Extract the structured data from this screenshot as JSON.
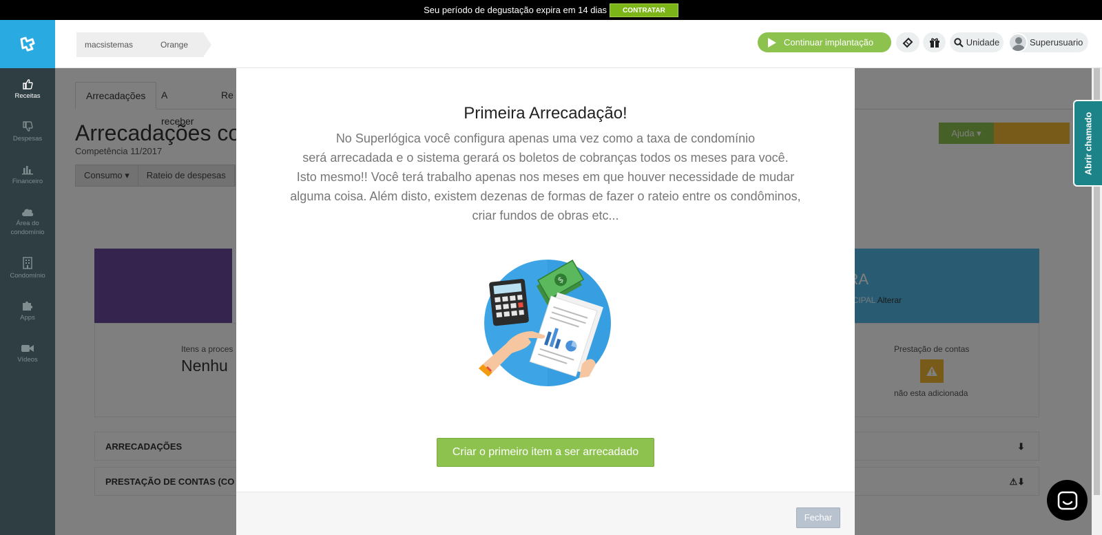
{
  "trial": {
    "text": "Seu período de degustação expira em 14 dias",
    "button": "CONTRATAR"
  },
  "sidebar": {
    "items": [
      {
        "label": "Receitas",
        "icon": "thumbs-up-icon"
      },
      {
        "label": "Despesas",
        "icon": "thumbs-down-icon"
      },
      {
        "label": "Financeiro",
        "icon": "bar-chart-icon"
      },
      {
        "label": "Área do condomínio",
        "icon": "cloud-icon"
      },
      {
        "label": "Condomínio",
        "icon": "building-icon"
      },
      {
        "label": "Apps",
        "icon": "puzzle-icon"
      },
      {
        "label": "Vídeos",
        "icon": "video-camera-icon"
      }
    ]
  },
  "header": {
    "breadcrumbs": [
      "macsistemas",
      "Orange"
    ],
    "continue_label": "Continuar implantação",
    "unit_label": "Unidade",
    "user_label": "Superusuario"
  },
  "main": {
    "tabs": [
      "Arrecadações",
      "A receber",
      "Re"
    ],
    "title": "Arrecadações co",
    "competencia": "Competência 11/2017",
    "toolbar": [
      "Consumo ▾",
      "Rateio de despesas"
    ],
    "help_label": "Ajuda ▾",
    "banner_big": "TRA",
    "banner_small": "RINCIPAL",
    "banner_link": "Alterar",
    "itens_label": "Itens a proces",
    "itens_value": "Nenhu",
    "prest_label": "Prestação de contas",
    "prest_status": "não esta adicionada",
    "sections": [
      "ARRECADAÇÕES",
      "PRESTAÇÃO DE CONTAS (CO"
    ]
  },
  "feedback_tab": "Abrir chamado",
  "modal": {
    "title": "Primeira Arrecadação!",
    "body_lines": [
      "No Superlógica você configura apenas uma vez como a taxa de condomínio",
      "será arrecadada e o sistema gerará os boletos de cobranças todos os meses para você.",
      "Isto mesmo!! Você terá trabalho apenas nos meses em que houver necessidade de mudar",
      "alguma coisa. Além disto, existem dezenas de formas de fazer o rateio entre os condôminos,",
      "criar fundos de obras etc..."
    ],
    "cta": "Criar o primeiro item a ser arrecadado",
    "close": "Fechar"
  },
  "colors": {
    "brand_blue": "#29abe2",
    "accent_green": "#8dc24e",
    "sidebar_bg": "#2f3e42",
    "feedback_teal": "#1c8388"
  }
}
